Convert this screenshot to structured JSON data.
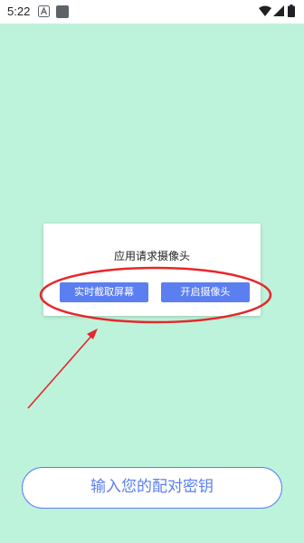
{
  "status_bar": {
    "time": "5:22"
  },
  "dialog": {
    "title": "应用请求摄像头",
    "capture_button": "实时截取屏幕",
    "camera_button": "开启摄像头"
  },
  "main": {
    "pair_key_button": "输入您的配对密钥"
  },
  "colors": {
    "background": "#bdf3db",
    "accent": "#5b7ef1",
    "annotation": "#e8262a"
  }
}
